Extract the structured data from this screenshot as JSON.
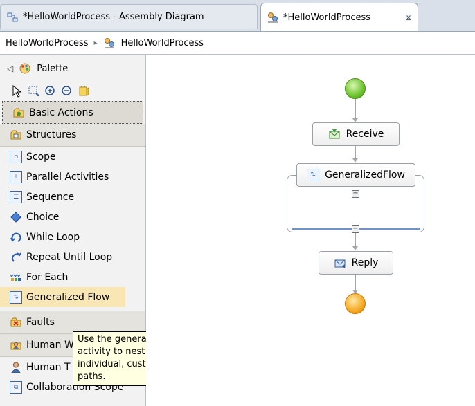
{
  "tabs": [
    {
      "label": "*HelloWorldProcess - Assembly Diagram"
    },
    {
      "label": "*HelloWorldProcess",
      "close": "⊠"
    }
  ],
  "breadcrumb": {
    "root": "HelloWorldProcess",
    "separator": "▸",
    "current": "HelloWorldProcess"
  },
  "palette": {
    "collapse": "◁",
    "title": "Palette",
    "drawers": {
      "basic": "Basic Actions",
      "structures": "Structures",
      "faults": "Faults"
    },
    "structure_items": [
      "Scope",
      "Parallel Activities",
      "Sequence",
      "Choice",
      "While Loop",
      "Repeat Until Loop",
      "For Each",
      "Generalized Flow"
    ],
    "lower_items": [
      "Human W",
      "Human T",
      "Collaboration Scope"
    ]
  },
  "tooltip": {
    "lines": [
      "Use the generalized flow",
      "activity to nest activities on",
      "individual, customized control",
      "paths."
    ]
  },
  "diagram": {
    "receive": "Receive",
    "gflow": "GeneralizedFlow",
    "reply": "Reply",
    "collapse": "−"
  },
  "colors": {
    "selected_item": "#f8e6b4",
    "tooltip_bg": "#ffffe1",
    "start_node": "#6cc32e",
    "end_node": "#f5a922"
  }
}
